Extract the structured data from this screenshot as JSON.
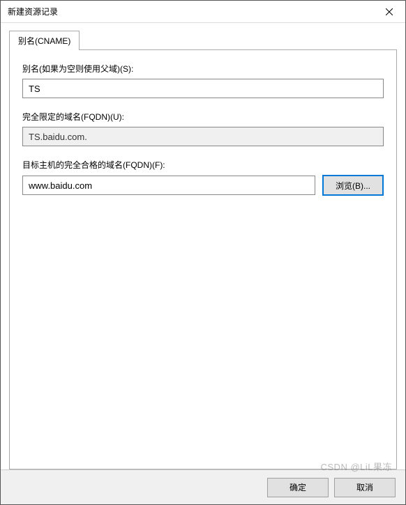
{
  "window": {
    "title": "新建资源记录"
  },
  "tab": {
    "label": "别名(CNAME)"
  },
  "fields": {
    "alias": {
      "label": "别名(如果为空则使用父域)(S):",
      "value": "TS"
    },
    "fqdn": {
      "label": "完全限定的域名(FQDN)(U):",
      "value": "TS.baidu.com."
    },
    "target": {
      "label": "目标主机的完全合格的域名(FQDN)(F):",
      "value": "www.baidu.com",
      "browse": "浏览(B)..."
    }
  },
  "buttons": {
    "ok": "确定",
    "cancel": "取消"
  },
  "watermark": "CSDN @LiL果冻"
}
